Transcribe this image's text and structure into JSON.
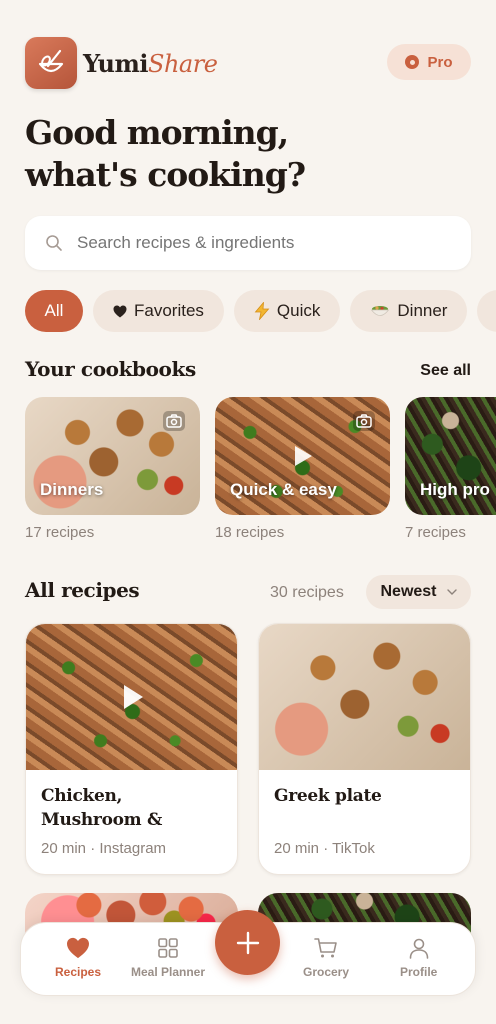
{
  "app": {
    "brand_main": "Yumi",
    "brand_accent": "Share",
    "pro_label": "Pro"
  },
  "greeting": {
    "line1": "Good morning,",
    "line2": "what's cooking?"
  },
  "search": {
    "placeholder": "Search recipes & ingredients"
  },
  "chips": [
    {
      "label": "All",
      "icon": "",
      "active": true
    },
    {
      "label": "Favorites",
      "icon": "heart-icon"
    },
    {
      "label": "Quick",
      "icon": "lightning-icon"
    },
    {
      "label": "Dinner",
      "icon": "bowl-icon"
    }
  ],
  "cookbooks": {
    "title": "Your cookbooks",
    "see_all": "See all",
    "items": [
      {
        "label": "Dinners",
        "count": "17 recipes",
        "media": "camera-icon"
      },
      {
        "label": "Quick & easy",
        "count": "18 recipes",
        "media": "camera-icon"
      },
      {
        "label": "High pro",
        "count": "7 recipes",
        "media": ""
      }
    ]
  },
  "recipes": {
    "title": "All recipes",
    "count": "30 recipes",
    "sort": "Newest",
    "items": [
      {
        "title": "Chicken, Mushroom & Broc...",
        "meta": "20 min · Instagram"
      },
      {
        "title": "Greek plate",
        "meta": "20 min · TikTok"
      }
    ]
  },
  "nav": {
    "items": [
      {
        "label": "Recipes",
        "icon": "heart-icon",
        "active": true
      },
      {
        "label": "Meal Planner",
        "icon": "grid-icon"
      },
      {
        "label": "Grocery",
        "icon": "cart-icon"
      },
      {
        "label": "Profile",
        "icon": "person-icon"
      }
    ]
  },
  "colors": {
    "accent": "#c9603f",
    "background": "#f8f4ef",
    "chip": "#f1e6dd"
  }
}
